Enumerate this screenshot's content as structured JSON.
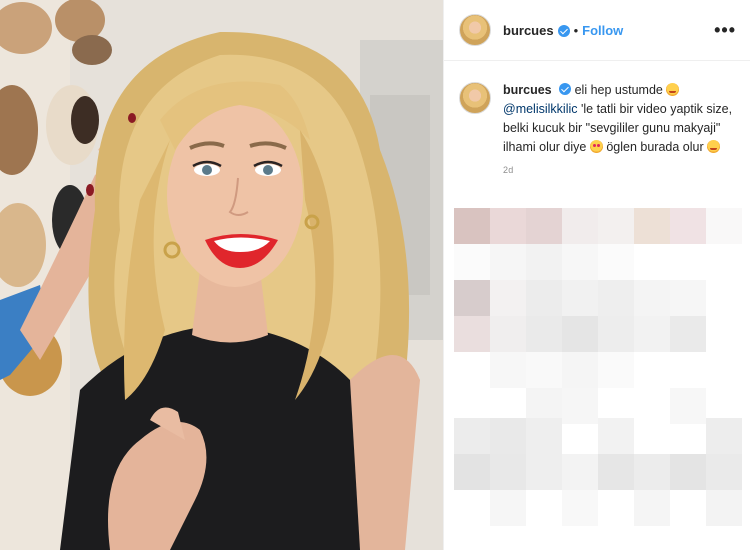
{
  "post": {
    "username": "burcues",
    "follow_label": "Follow",
    "separator": "•",
    "more_label": "•••"
  },
  "caption": {
    "username": "burcues",
    "part1": "eli hep ustumde",
    "mention": "@melisilkkilic",
    "part2": "'le tatli bir video yaptik size, belki kucuk bir \"sevgililer gunu makyaji\" ilhami olur diye",
    "part3": "öglen burada olur",
    "time": "2d"
  },
  "icons": {
    "verified": "verified-badge-icon",
    "more": "more-options-icon",
    "emoji1": "blushing-smile-emoji",
    "emoji2": "heart-eyes-emoji",
    "emoji3": "kissing-emoji"
  },
  "colors": {
    "accent": "#3897f0",
    "mention": "#00376b",
    "text": "#262626",
    "muted": "#8e8e8e"
  }
}
